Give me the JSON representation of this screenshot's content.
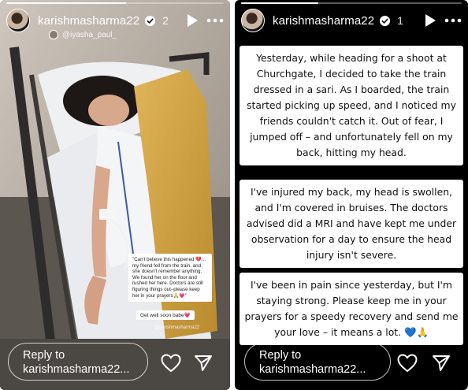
{
  "colors": {
    "instagram_white": "#ffffff",
    "story_black": "#000000",
    "heart_emoji": "#e0245e",
    "blue_heart": "#1d9bf0"
  },
  "left_story": {
    "username": "karishmasharma22",
    "time": "2",
    "mention": "@iyasha_paul_",
    "progress_fraction": 0.55,
    "caption_sticker": "\"Can't believe this happened 💔... my friend fell from the train, and she doesn't remember anything. We found her on the floor and rushed her here. Doctors are still figuring things out–please keep her in your prayers🙏💗\"",
    "small_sticker": "Get well soon babe💗",
    "tag_sticker": "@karishmasharma22",
    "reply_line1": "Reply to",
    "reply_line2": "karishmasharma22...",
    "icons": [
      "verified-badge-icon",
      "play-icon",
      "more-icon",
      "heart-icon",
      "send-icon"
    ]
  },
  "right_story": {
    "username": "karishmasharma22",
    "time": "1",
    "progress_fraction": 0.35,
    "paragraph1": "Yesterday, while heading for a shoot at Churchgate, I decided to take the train dressed in a sari. As I boarded, the train started picking up speed, and I noticed my friends couldn't catch it. Out of fear, I jumped off – and unfortunately fell on my back, hitting my head.",
    "paragraph2": "I've injured my back, my head is swollen, and I'm covered in bruises. The doctors advised did a MRI and have kept me under observation for a day to ensure the head injury isn't severe.",
    "paragraph3": "I've been in pain since yesterday, but I'm staying strong. Please keep me in your prayers for a speedy recovery and send me your love – it means a lot. 💙🙏",
    "reply_line1": "Reply to",
    "reply_line2": "karishmasharma22...",
    "icons": [
      "verified-badge-icon",
      "play-icon",
      "more-icon",
      "heart-icon",
      "send-icon"
    ]
  }
}
